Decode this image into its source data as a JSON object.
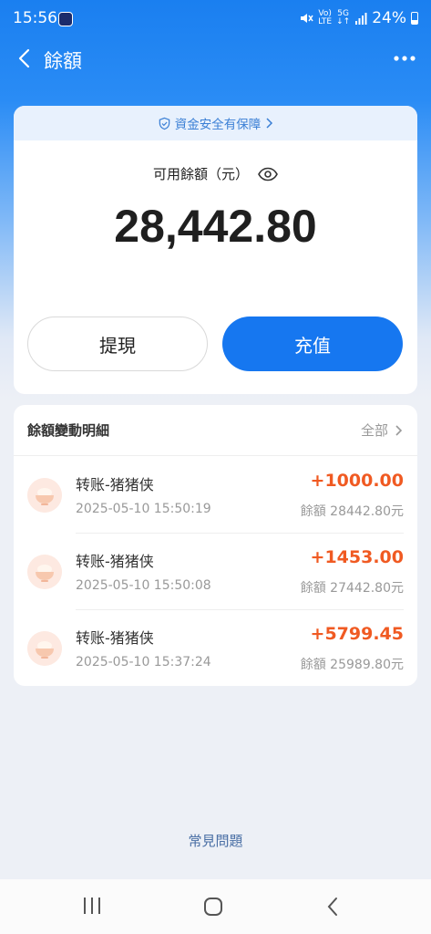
{
  "status_bar": {
    "time": "15:56",
    "volte_top": "Vo)",
    "volte_bottom": "LTE",
    "network_top": "5G",
    "network_bottom": "↓↑",
    "battery": "24%"
  },
  "header": {
    "title": "餘額"
  },
  "balance_card": {
    "security_text": "資金安全有保障",
    "label": "可用餘額（元）",
    "amount": "28,442.80",
    "withdraw_label": "提現",
    "recharge_label": "充值"
  },
  "details": {
    "title": "餘額變動明細",
    "view_all_label": "全部",
    "transactions": [
      {
        "name": "转账-猪猪侠",
        "time": "2025-05-10 15:50:19",
        "amount": "+1000.00",
        "balance": "餘額 28442.80元"
      },
      {
        "name": "转账-猪猪侠",
        "time": "2025-05-10 15:50:08",
        "amount": "+1453.00",
        "balance": "餘額 27442.80元"
      },
      {
        "name": "转账-猪猪侠",
        "time": "2025-05-10 15:37:24",
        "amount": "+5799.45",
        "balance": "餘額 25989.80元"
      }
    ]
  },
  "faq_label": "常見問題",
  "colors": {
    "primary_blue": "#1677f0",
    "amount_orange": "#f05a22"
  },
  "icons": [
    "back-icon",
    "more-icon",
    "shield-icon",
    "eye-icon",
    "chevron-right-icon",
    "nav-recent-icon",
    "nav-home-icon",
    "nav-back-icon"
  ]
}
